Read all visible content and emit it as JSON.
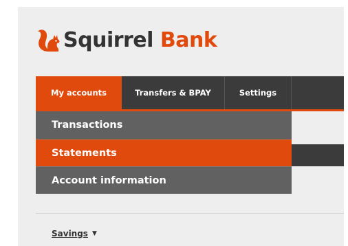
{
  "brand": {
    "name_part1": "Squirrel",
    "name_part2": "Bank",
    "accent_color": "#e04a0c",
    "logo_icon": "squirrel-icon"
  },
  "nav": {
    "tabs": [
      {
        "label": "My accounts",
        "active": true
      },
      {
        "label": "Transfers & BPAY",
        "active": false
      },
      {
        "label": "Settings",
        "active": false
      }
    ]
  },
  "dropdown": {
    "items": [
      {
        "label": "Transactions",
        "selected": false
      },
      {
        "label": "Statements",
        "selected": true
      },
      {
        "label": "Account information",
        "selected": false
      }
    ]
  },
  "account_selector": {
    "label": "Savings",
    "icon": "caret-down-icon"
  }
}
